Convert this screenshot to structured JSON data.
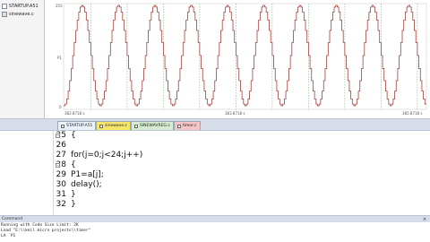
{
  "project": {
    "items": [
      {
        "label": "STARTUP.A51",
        "icon": "asm-file-icon"
      },
      {
        "label": "sinewave.c",
        "icon": "c-file-icon"
      }
    ]
  },
  "analyzer": {
    "y_top": "255",
    "y_mid": "P1",
    "y_bottom": "0",
    "x_left": "382.8718 s",
    "x_mid": "383.8718 s",
    "x_right": "385.8718 s",
    "wave_color": "#a0403a",
    "grid_color": "#6f9e6f"
  },
  "tabs": [
    {
      "label": "STARTUP.A51",
      "bg": "#eaf1fb"
    },
    {
      "label": "sinewave.c",
      "bg": "#f5e66b"
    },
    {
      "label": "SINEWAVREG.c",
      "bg": "#d5ecd0"
    },
    {
      "label": "timer.c",
      "bg": "#f5c5c5"
    }
  ],
  "editor": {
    "lines": [
      {
        "no": "25",
        "text": "{",
        "fold": true
      },
      {
        "no": "26",
        "text": "",
        "fold": false
      },
      {
        "no": "27",
        "text": "for(j=0;j<24;j++)",
        "fold": false
      },
      {
        "no": "28",
        "text": "{",
        "fold": true
      },
      {
        "no": "29",
        "text": "P1=a[j];",
        "fold": false
      },
      {
        "no": "30",
        "text": "delay();",
        "fold": false
      },
      {
        "no": "31",
        "text": "}",
        "fold": false
      },
      {
        "no": "32",
        "text": "}",
        "fold": false
      }
    ]
  },
  "command": {
    "title": "Command",
    "close": "×",
    "lines": [
      "Running with Code Size Limit: 2K",
      "Load \"E:\\\\keil micro projects\\\\timer\"",
      "LA `P1"
    ]
  }
}
